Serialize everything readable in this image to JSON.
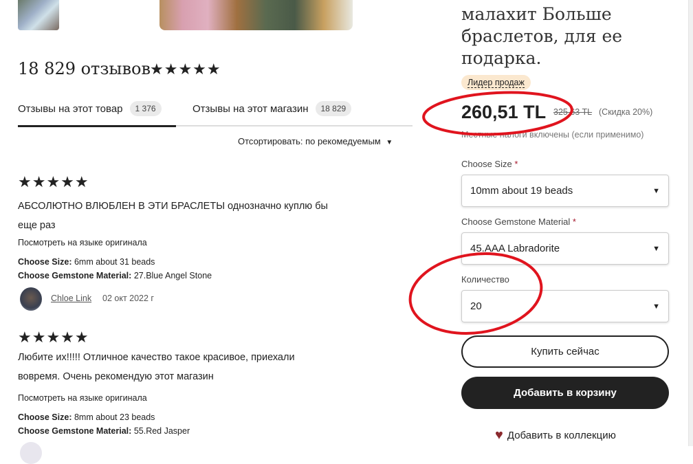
{
  "product": {
    "title_lines": [
      "малахит Больше",
      "браслетов, для ее",
      "подарка."
    ],
    "badge": "Лидер продаж",
    "price": "260,51 TL",
    "old_price": "325,63 TL",
    "discount": "(Скидка 20%)",
    "tax_note": "Местные налоги включены (если применимо)",
    "size_label": "Choose Size",
    "size_value": "10mm about 19 beads",
    "material_label": "Choose Gemstone Material",
    "material_value": "45.AAA Labradorite",
    "qty_label": "Количество",
    "qty_value": "20",
    "buy_now": "Купить сейчас",
    "add_cart": "Добавить в корзину",
    "add_collection": "Добавить в коллекцию",
    "required_mark": "*"
  },
  "reviews": {
    "heading": "18 829 отзывов",
    "stars": "★★★★★",
    "tabs": [
      {
        "label": "Отзывы на этот товар",
        "count": "1 376"
      },
      {
        "label": "Отзывы на этот магазин",
        "count": "18 829"
      }
    ],
    "sort": "Отсортировать: по рекомедуемым",
    "items": [
      {
        "stars": "★★★★★",
        "text_lines": [
          "АБСОЛЮТНО ВЛЮБЛЕН В ЭТИ БРАСЛЕТЫ однозначно куплю бы",
          "еще раз"
        ],
        "translate": "Посмотреть на языке оригинала",
        "size_key": "Choose Size:",
        "size": "6mm about 31 beads",
        "mat_key": "Choose Gemstone Material:",
        "mat": "27.Blue Angel Stone",
        "author": "Chloe Link",
        "date": "02 окт 2022 г"
      },
      {
        "stars": "★★★★★",
        "text_lines": [
          "Любите их!!!!! Отличное качество такое красивое, приехали",
          "вовремя. Очень рекомендую этот магазин"
        ],
        "translate": "Посмотреть на языке оригинала",
        "size_key": "Choose Size:",
        "size": "8mm about 23 beads",
        "mat_key": "Choose Gemstone Material:",
        "mat": "55.Red Jasper"
      }
    ]
  },
  "colors": {
    "annotation": "#e0141e",
    "heart": "#8b2a2e",
    "button_dark": "#222222"
  }
}
